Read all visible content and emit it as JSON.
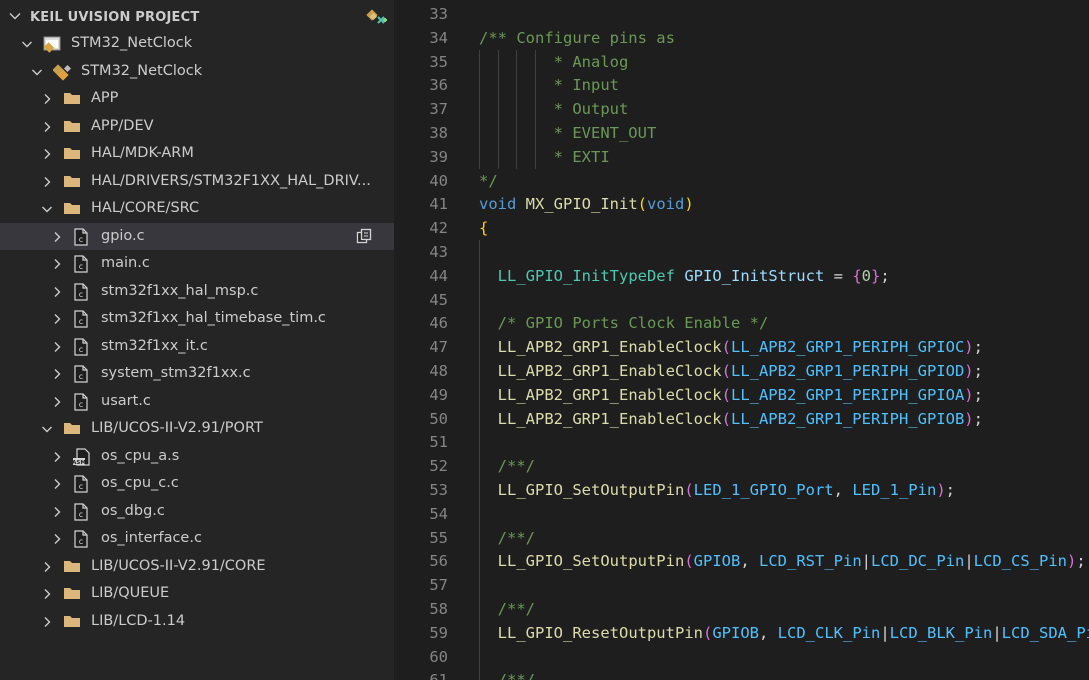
{
  "sidebar": {
    "header": "KEIL UVISION PROJECT",
    "items": [
      {
        "label": "STM32_NetClock",
        "level": 1,
        "expanded": true,
        "icon": "project-icon",
        "kind": "project"
      },
      {
        "label": "STM32_NetClock",
        "level": 2,
        "expanded": true,
        "icon": "target-icon",
        "kind": "target"
      },
      {
        "label": "APP",
        "level": 3,
        "expanded": false,
        "icon": "folder-icon",
        "kind": "folder"
      },
      {
        "label": "APP/DEV",
        "level": 3,
        "expanded": false,
        "icon": "folder-icon",
        "kind": "folder"
      },
      {
        "label": "HAL/MDK-ARM",
        "level": 3,
        "expanded": false,
        "icon": "folder-icon",
        "kind": "folder"
      },
      {
        "label": "HAL/DRIVERS/STM32F1XX_HAL_DRIV...",
        "level": 3,
        "expanded": false,
        "icon": "folder-icon",
        "kind": "folder"
      },
      {
        "label": "HAL/CORE/SRC",
        "level": 3,
        "expanded": true,
        "icon": "folder-icon",
        "kind": "folder"
      },
      {
        "label": "gpio.c",
        "level": 4,
        "expanded": false,
        "icon": "c-file-icon",
        "kind": "file",
        "selected": true
      },
      {
        "label": "main.c",
        "level": 4,
        "expanded": false,
        "icon": "c-file-icon",
        "kind": "file"
      },
      {
        "label": "stm32f1xx_hal_msp.c",
        "level": 4,
        "expanded": false,
        "icon": "c-file-icon",
        "kind": "file"
      },
      {
        "label": "stm32f1xx_hal_timebase_tim.c",
        "level": 4,
        "expanded": false,
        "icon": "c-file-icon",
        "kind": "file"
      },
      {
        "label": "stm32f1xx_it.c",
        "level": 4,
        "expanded": false,
        "icon": "c-file-icon",
        "kind": "file"
      },
      {
        "label": "system_stm32f1xx.c",
        "level": 4,
        "expanded": false,
        "icon": "c-file-icon",
        "kind": "file"
      },
      {
        "label": "usart.c",
        "level": 4,
        "expanded": false,
        "icon": "c-file-icon",
        "kind": "file"
      },
      {
        "label": "LIB/UCOS-II-V2.91/PORT",
        "level": 3,
        "expanded": true,
        "icon": "folder-icon",
        "kind": "folder"
      },
      {
        "label": "os_cpu_a.s",
        "level": 4,
        "expanded": false,
        "icon": "asm-file-icon",
        "kind": "asm"
      },
      {
        "label": "os_cpu_c.c",
        "level": 4,
        "expanded": false,
        "icon": "c-file-icon",
        "kind": "file"
      },
      {
        "label": "os_dbg.c",
        "level": 4,
        "expanded": false,
        "icon": "c-file-icon",
        "kind": "file"
      },
      {
        "label": "os_interface.c",
        "level": 4,
        "expanded": false,
        "icon": "c-file-icon",
        "kind": "file"
      },
      {
        "label": "LIB/UCOS-II-V2.91/CORE",
        "level": 3,
        "expanded": false,
        "icon": "folder-icon",
        "kind": "folder"
      },
      {
        "label": "LIB/QUEUE",
        "level": 3,
        "expanded": false,
        "icon": "folder-icon",
        "kind": "folder"
      },
      {
        "label": "LIB/LCD-1.14",
        "level": 3,
        "expanded": false,
        "icon": "folder-icon",
        "kind": "folder"
      }
    ]
  },
  "editor": {
    "lines": [
      {
        "n": "33",
        "tokens": []
      },
      {
        "n": "34",
        "tokens": [
          [
            "c",
            "/** Configure pins as"
          ]
        ]
      },
      {
        "n": "35",
        "tokens": [
          [
            "c",
            "        * Analog"
          ]
        ]
      },
      {
        "n": "36",
        "tokens": [
          [
            "c",
            "        * Input"
          ]
        ]
      },
      {
        "n": "37",
        "tokens": [
          [
            "c",
            "        * Output"
          ]
        ]
      },
      {
        "n": "38",
        "tokens": [
          [
            "c",
            "        * EVENT_OUT"
          ]
        ]
      },
      {
        "n": "39",
        "tokens": [
          [
            "c",
            "        * EXTI"
          ]
        ]
      },
      {
        "n": "40",
        "tokens": [
          [
            "c",
            "*/"
          ]
        ]
      },
      {
        "n": "41",
        "tokens": [
          [
            "k",
            "void"
          ],
          [
            "p",
            " "
          ],
          [
            "f",
            "MX_GPIO_Init"
          ],
          [
            "b1",
            "("
          ],
          [
            "k",
            "void"
          ],
          [
            "b1",
            ")"
          ]
        ]
      },
      {
        "n": "42",
        "tokens": [
          [
            "b1",
            "{"
          ]
        ]
      },
      {
        "n": "43",
        "tokens": []
      },
      {
        "n": "44",
        "tokens": [
          [
            "p",
            "  "
          ],
          [
            "t",
            "LL_GPIO_InitTypeDef"
          ],
          [
            "p",
            " "
          ],
          [
            "v",
            "GPIO_InitStruct"
          ],
          [
            "p",
            " = "
          ],
          [
            "b2",
            "{"
          ],
          [
            "n",
            "0"
          ],
          [
            "b2",
            "}"
          ],
          [
            "p",
            ";"
          ]
        ]
      },
      {
        "n": "45",
        "tokens": []
      },
      {
        "n": "46",
        "tokens": [
          [
            "p",
            "  "
          ],
          [
            "c",
            "/* GPIO Ports Clock Enable */"
          ]
        ]
      },
      {
        "n": "47",
        "tokens": [
          [
            "p",
            "  "
          ],
          [
            "f",
            "LL_APB2_GRP1_EnableClock"
          ],
          [
            "b2",
            "("
          ],
          [
            "m",
            "LL_APB2_GRP1_PERIPH_GPIOC"
          ],
          [
            "b2",
            ")"
          ],
          [
            "p",
            ";"
          ]
        ]
      },
      {
        "n": "48",
        "tokens": [
          [
            "p",
            "  "
          ],
          [
            "f",
            "LL_APB2_GRP1_EnableClock"
          ],
          [
            "b2",
            "("
          ],
          [
            "m",
            "LL_APB2_GRP1_PERIPH_GPIOD"
          ],
          [
            "b2",
            ")"
          ],
          [
            "p",
            ";"
          ]
        ]
      },
      {
        "n": "49",
        "tokens": [
          [
            "p",
            "  "
          ],
          [
            "f",
            "LL_APB2_GRP1_EnableClock"
          ],
          [
            "b2",
            "("
          ],
          [
            "m",
            "LL_APB2_GRP1_PERIPH_GPIOA"
          ],
          [
            "b2",
            ")"
          ],
          [
            "p",
            ";"
          ]
        ]
      },
      {
        "n": "50",
        "tokens": [
          [
            "p",
            "  "
          ],
          [
            "f",
            "LL_APB2_GRP1_EnableClock"
          ],
          [
            "b2",
            "("
          ],
          [
            "m",
            "LL_APB2_GRP1_PERIPH_GPIOB"
          ],
          [
            "b2",
            ")"
          ],
          [
            "p",
            ";"
          ]
        ]
      },
      {
        "n": "51",
        "tokens": []
      },
      {
        "n": "52",
        "tokens": [
          [
            "p",
            "  "
          ],
          [
            "c",
            "/**/"
          ]
        ]
      },
      {
        "n": "53",
        "tokens": [
          [
            "p",
            "  "
          ],
          [
            "f",
            "LL_GPIO_SetOutputPin"
          ],
          [
            "b2",
            "("
          ],
          [
            "m",
            "LED_1_GPIO_Port"
          ],
          [
            "p",
            ", "
          ],
          [
            "m",
            "LED_1_Pin"
          ],
          [
            "b2",
            ")"
          ],
          [
            "p",
            ";"
          ]
        ]
      },
      {
        "n": "54",
        "tokens": []
      },
      {
        "n": "55",
        "tokens": [
          [
            "p",
            "  "
          ],
          [
            "c",
            "/**/"
          ]
        ]
      },
      {
        "n": "56",
        "tokens": [
          [
            "p",
            "  "
          ],
          [
            "f",
            "LL_GPIO_SetOutputPin"
          ],
          [
            "b2",
            "("
          ],
          [
            "m",
            "GPIOB"
          ],
          [
            "p",
            ", "
          ],
          [
            "m",
            "LCD_RST_Pin"
          ],
          [
            "p",
            "|"
          ],
          [
            "m",
            "LCD_DC_Pin"
          ],
          [
            "p",
            "|"
          ],
          [
            "m",
            "LCD_CS_Pin"
          ],
          [
            "b2",
            ")"
          ],
          [
            "p",
            ";"
          ]
        ]
      },
      {
        "n": "57",
        "tokens": []
      },
      {
        "n": "58",
        "tokens": [
          [
            "p",
            "  "
          ],
          [
            "c",
            "/**/"
          ]
        ]
      },
      {
        "n": "59",
        "tokens": [
          [
            "p",
            "  "
          ],
          [
            "f",
            "LL_GPIO_ResetOutputPin"
          ],
          [
            "b2",
            "("
          ],
          [
            "m",
            "GPIOB"
          ],
          [
            "p",
            ", "
          ],
          [
            "m",
            "LCD_CLK_Pin"
          ],
          [
            "p",
            "|"
          ],
          [
            "m",
            "LCD_BLK_Pin"
          ],
          [
            "p",
            "|"
          ],
          [
            "m",
            "LCD_SDA_Pin"
          ],
          [
            "b2",
            ")"
          ],
          [
            "p",
            ";"
          ]
        ]
      },
      {
        "n": "60",
        "tokens": []
      },
      {
        "n": "61",
        "tokens": [
          [
            "p",
            "  "
          ],
          [
            "c",
            "/**/"
          ]
        ]
      }
    ]
  },
  "colors": {
    "sidebar_bg": "#252526",
    "editor_bg": "#1e1e1e",
    "selection_bg": "#37373d",
    "folder": "#dcb67a",
    "comment": "#6a9955",
    "keyword": "#569cd6",
    "function": "#dcdcaa",
    "type": "#4ec9b0",
    "macro": "#4fc1ff"
  }
}
